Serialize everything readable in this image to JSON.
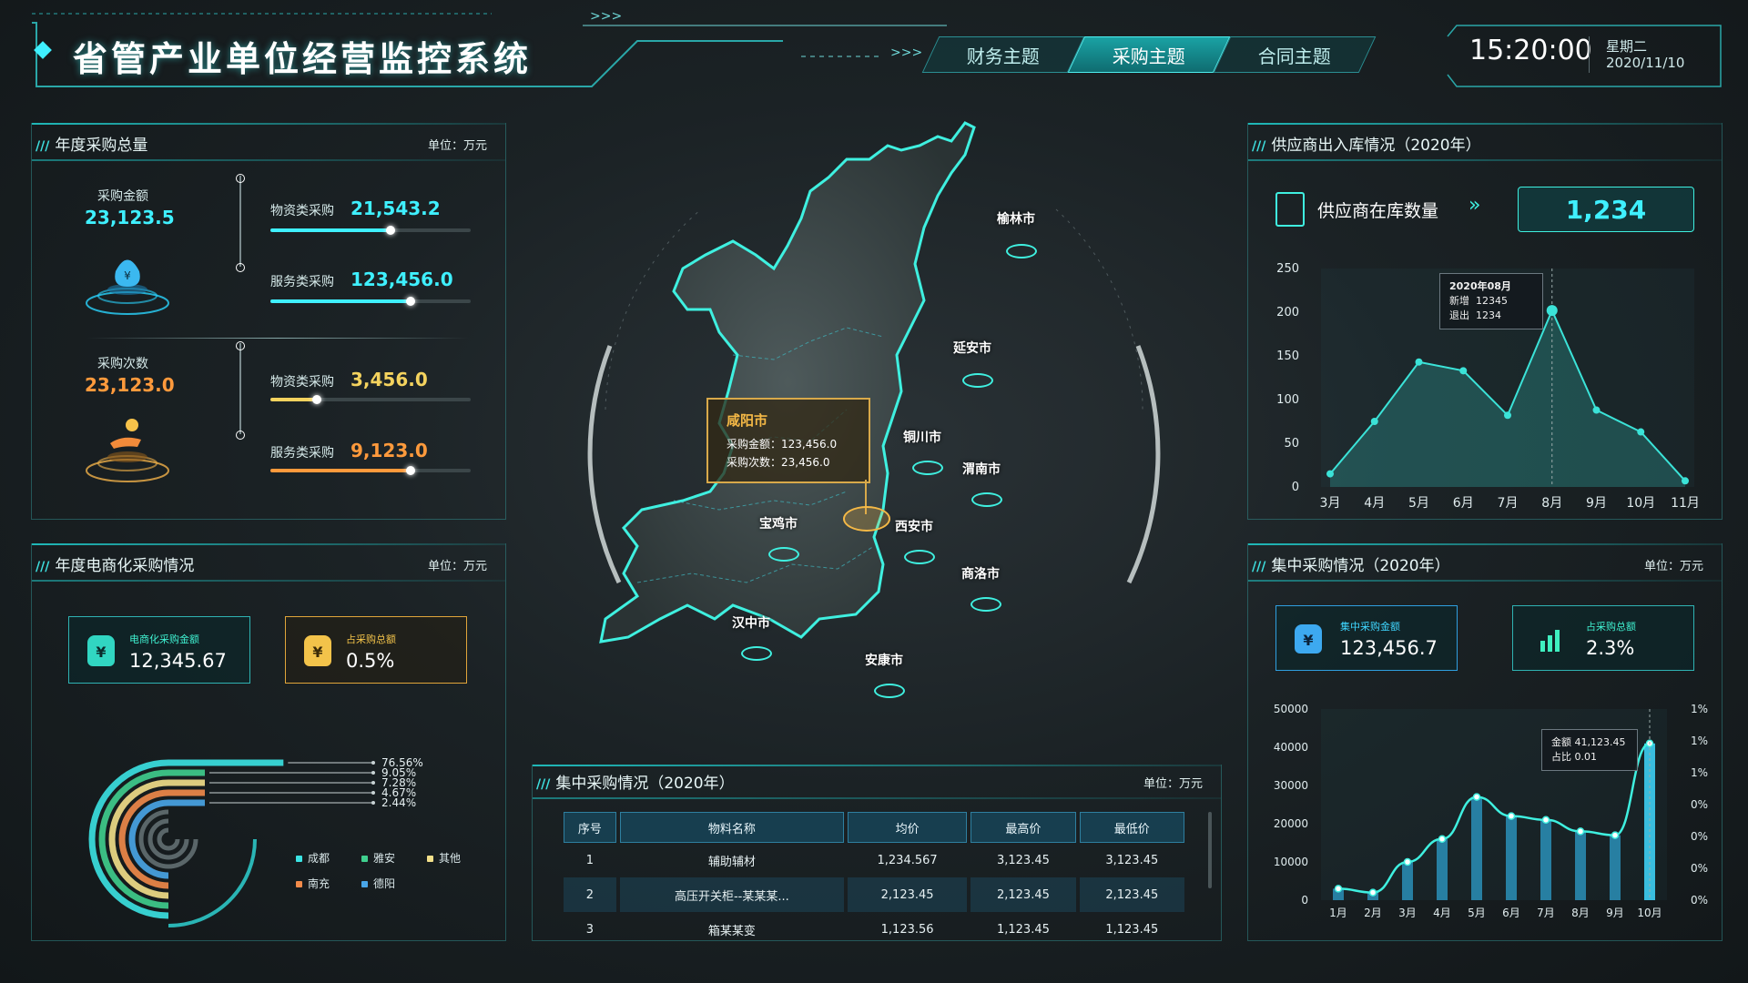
{
  "header": {
    "title": "省管产业单位经营监控系统",
    "arrows": ">>>",
    "tabs": [
      {
        "label": "财务主题",
        "active": false
      },
      {
        "label": "采购主题",
        "active": true
      },
      {
        "label": "合同主题",
        "active": false
      }
    ],
    "time": "15:20:00",
    "weekday": "星期二",
    "date": "2020/11/10"
  },
  "annual_purchase": {
    "title": "年度采购总量",
    "unit": "单位：万元",
    "amount_label": "采购金额",
    "amount_value": "23,123.5",
    "count_label": "采购次数",
    "count_value": "23,123.0",
    "amount_rows": [
      {
        "label": "物资类采购",
        "value": "21,543.2",
        "progress": 0.6,
        "color": "#3ff0ff"
      },
      {
        "label": "服务类采购",
        "value": "123,456.0",
        "progress": 0.7,
        "color": "#3ff0ff"
      }
    ],
    "count_rows": [
      {
        "label": "物资类采购",
        "value": "3,456.0",
        "progress": 0.23,
        "color": "#f4d35e"
      },
      {
        "label": "服务类采购",
        "value": "9,123.0",
        "progress": 0.7,
        "color": "#ff9a3c"
      }
    ]
  },
  "ecommerce": {
    "title": "年度电商化采购情况",
    "unit": "单位：万元",
    "card1_label": "电商化采购金额",
    "card1_value": "12,345.67",
    "card2_label": "占采购总额",
    "card2_value": "0.5%",
    "chart_data": {
      "type": "bar",
      "categories": [
        "成都",
        "雅安",
        "其他",
        "南充",
        "德阳"
      ],
      "values": [
        76.56,
        9.05,
        7.28,
        4.67,
        2.44
      ],
      "value_labels": [
        "76.56%",
        "9.05%",
        "7.28%",
        "4.67%",
        "2.44%"
      ],
      "colors": [
        "#3be3e3",
        "#3fcf8e",
        "#f3e08a",
        "#f28b4a",
        "#49a6e8"
      ]
    }
  },
  "map": {
    "tooltip_city": "咸阳市",
    "tooltip_amount_label": "采购金额：",
    "tooltip_amount": "123,456.0",
    "tooltip_count_label": "采购次数：",
    "tooltip_count": "23,456.0",
    "cities": [
      "榆林市",
      "延安市",
      "铜川市",
      "渭南市",
      "宝鸡市",
      "西安市",
      "商洛市",
      "汉中市",
      "安康市"
    ]
  },
  "central_table": {
    "title": "集中采购情况（2020年）",
    "unit": "单位：万元",
    "columns": [
      "序号",
      "物料名称",
      "均价",
      "最高价",
      "最低价"
    ],
    "rows": [
      [
        "1",
        "辅助辅材",
        "1,234.567",
        "3,123.45",
        "3,123.45"
      ],
      [
        "2",
        "高压开关柜--某某某...",
        "2,123.45",
        "2,123.45",
        "2,123.45"
      ],
      [
        "3",
        "箱某某变",
        "1,123.56",
        "1,123.45",
        "1,123.45"
      ]
    ]
  },
  "supplier": {
    "title": "供应商出入库情况（2020年）",
    "count_label": "供应商在库数量",
    "count_value": "1,234",
    "tooltip_month": "2020年08月",
    "tooltip_new_label": "新增",
    "tooltip_new": "12345",
    "tooltip_exit_label": "退出",
    "tooltip_exit": "1234",
    "chart_data": {
      "type": "line",
      "categories": [
        "3月",
        "4月",
        "5月",
        "6月",
        "7月",
        "8月",
        "9月",
        "10月",
        "11月"
      ],
      "values": [
        15,
        75,
        143,
        133,
        82,
        202,
        88,
        63,
        7
      ],
      "ylim": [
        0,
        250
      ],
      "yticks": [
        "0",
        "50",
        "100",
        "150",
        "200",
        "250"
      ],
      "color": "#3be3d8"
    }
  },
  "central_right": {
    "title": "集中采购情况（2020年）",
    "unit": "单位：万元",
    "card1_label": "集中采购金额",
    "card1_value": "123,456.7",
    "card2_label": "占采购总额",
    "card2_value": "2.3%",
    "tooltip_amount": "金额 41,123.45",
    "tooltip_ratio": "占比 0.01",
    "chart_data": {
      "type": "bar",
      "categories": [
        "1月",
        "2月",
        "3月",
        "4月",
        "5月",
        "6月",
        "7月",
        "8月",
        "9月",
        "10月"
      ],
      "values": [
        3000,
        2000,
        10000,
        16000,
        27000,
        22000,
        21000,
        18000,
        17000,
        41000
      ],
      "ylim": [
        0,
        50000
      ],
      "yticks": [
        "0",
        "10000",
        "20000",
        "30000",
        "40000",
        "50000"
      ],
      "y2ticks": [
        "0%",
        "0%",
        "0%",
        "0%",
        "1%",
        "1%",
        "1%"
      ],
      "color": "#2ec8e8"
    }
  }
}
